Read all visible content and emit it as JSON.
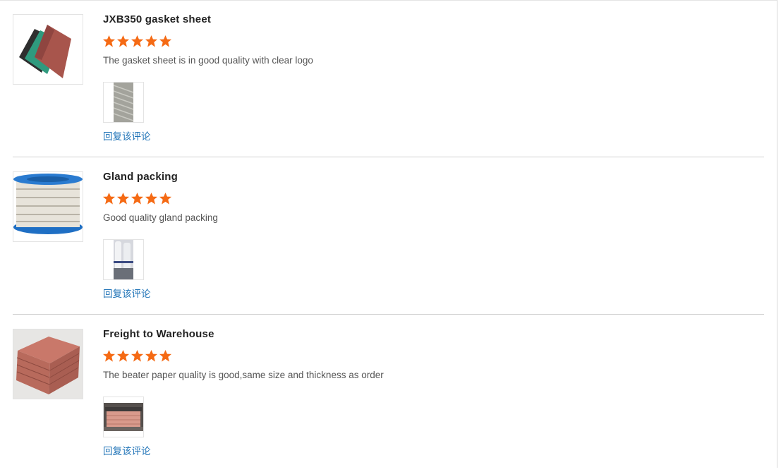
{
  "colors": {
    "star": "#f56a14",
    "reply_link": "#1f73b7",
    "divider": "#d0d0d0"
  },
  "reviews": [
    {
      "title": "JXB350 gasket sheet",
      "rating": 5,
      "comment": "The gasket sheet is in good quality with clear logo",
      "product_image": "gasket-sheet-image",
      "photo_image": "gasket-texture-photo",
      "reply_label": "回复该评论"
    },
    {
      "title": "Gland packing",
      "rating": 5,
      "comment": "Good quality gland packing",
      "product_image": "gland-packing-spool-image",
      "photo_image": "packing-rolls-photo",
      "reply_label": "回复该评论"
    },
    {
      "title": "Freight to Warehouse",
      "rating": 5,
      "comment": "The beater paper quality is good,same size and thickness as order",
      "product_image": "beater-paper-stack-image",
      "photo_image": "warehouse-pallet-photo",
      "reply_label": "回复该评论"
    }
  ]
}
